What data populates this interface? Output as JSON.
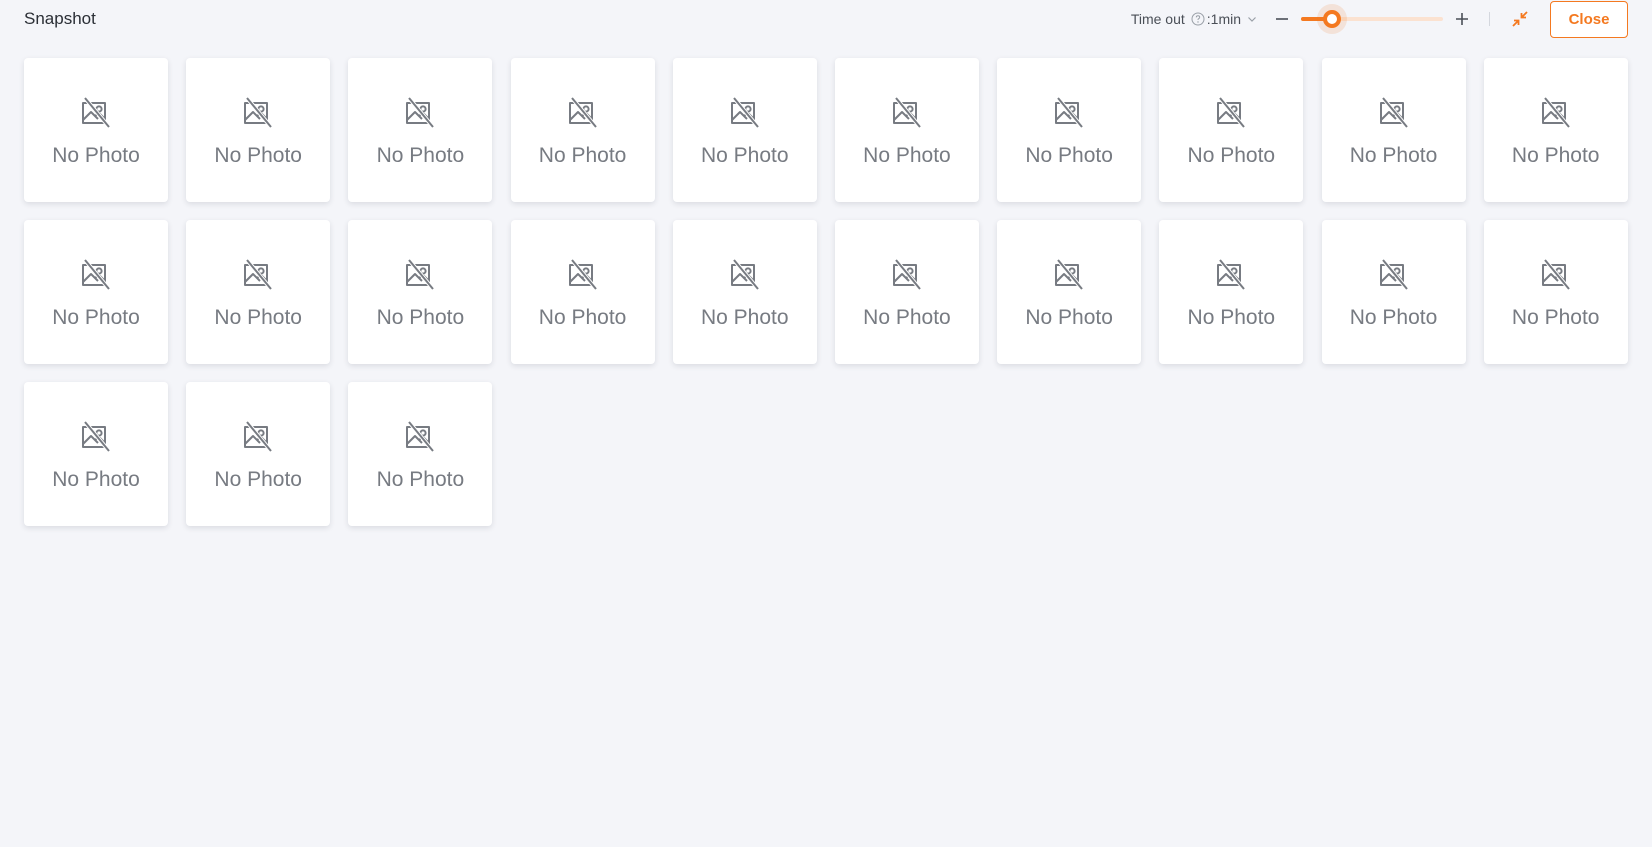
{
  "header": {
    "title": "Snapshot",
    "timeout_label": "Time out",
    "timeout_value": ":1min",
    "close_label": "Close"
  },
  "zoom": {
    "level": 0.22
  },
  "colors": {
    "accent": "#f47920",
    "background": "#f4f5f9"
  },
  "icons": {
    "help": "question-circle-icon",
    "dropdown": "chevron-down-icon",
    "zoom_out": "minus-icon",
    "zoom_in": "plus-icon",
    "shrink": "shrink-icon",
    "placeholder": "no-photo-icon"
  },
  "snapshots": [
    {
      "label": "No Photo"
    },
    {
      "label": "No Photo"
    },
    {
      "label": "No Photo"
    },
    {
      "label": "No Photo"
    },
    {
      "label": "No Photo"
    },
    {
      "label": "No Photo"
    },
    {
      "label": "No Photo"
    },
    {
      "label": "No Photo"
    },
    {
      "label": "No Photo"
    },
    {
      "label": "No Photo"
    },
    {
      "label": "No Photo"
    },
    {
      "label": "No Photo"
    },
    {
      "label": "No Photo"
    },
    {
      "label": "No Photo"
    },
    {
      "label": "No Photo"
    },
    {
      "label": "No Photo"
    },
    {
      "label": "No Photo"
    },
    {
      "label": "No Photo"
    },
    {
      "label": "No Photo"
    },
    {
      "label": "No Photo"
    },
    {
      "label": "No Photo"
    },
    {
      "label": "No Photo"
    },
    {
      "label": "No Photo"
    }
  ]
}
